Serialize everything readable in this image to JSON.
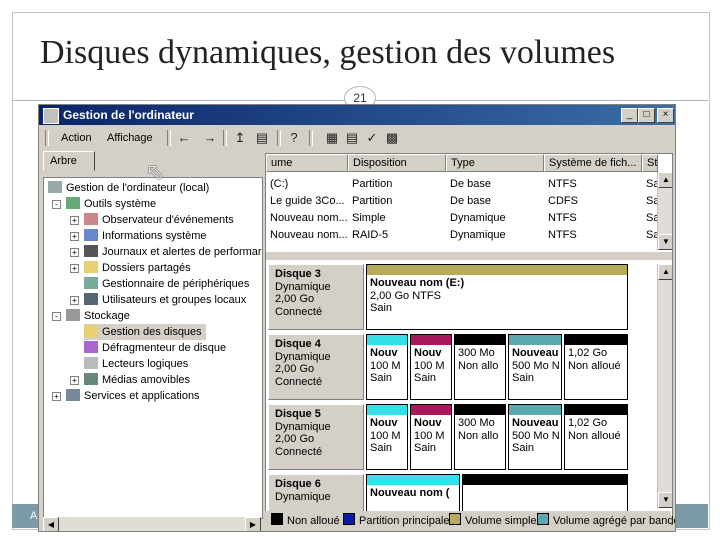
{
  "slide": {
    "title": "Disques dynamiques, gestion des volumes",
    "number": "21",
    "footer": "Ac"
  },
  "window": {
    "title": "Gestion de l'ordinateur",
    "menu": [
      "Action",
      "Affichage"
    ],
    "tab": "Arbre"
  },
  "tree": [
    {
      "label": "Gestion de l'ordinateur (local)",
      "icon": "computer-icon"
    },
    {
      "label": "Outils système",
      "icon": "tools-icon"
    },
    {
      "label": "Observateur d'événements",
      "icon": "event-viewer-icon"
    },
    {
      "label": "Informations système",
      "icon": "info-icon"
    },
    {
      "label": "Journaux et alertes de performar",
      "icon": "performance-icon"
    },
    {
      "label": "Dossiers partagés",
      "icon": "folder-icon"
    },
    {
      "label": "Gestionnaire de périphériques",
      "icon": "device-manager-icon"
    },
    {
      "label": "Utilisateurs et groupes locaux",
      "icon": "users-icon"
    },
    {
      "label": "Stockage",
      "icon": "storage-icon"
    },
    {
      "label": "Gestion des disques",
      "icon": "disk-management-icon"
    },
    {
      "label": "Défragmenteur de disque",
      "icon": "defrag-icon"
    },
    {
      "label": "Lecteurs logiques",
      "icon": "drive-icon"
    },
    {
      "label": "Médias amovibles",
      "icon": "removable-media-icon"
    },
    {
      "label": "Services et applications",
      "icon": "services-icon"
    }
  ],
  "volumes": {
    "columns": [
      "ume",
      "Disposition",
      "Type",
      "Système de fich...",
      "St"
    ],
    "rows": [
      [
        "(C:)",
        "Partition",
        "De base",
        "NTFS",
        "Sa"
      ],
      [
        "Le guide 3Co...",
        "Partition",
        "De base",
        "CDFS",
        "Sa"
      ],
      [
        "Nouveau nom...",
        "Simple",
        "Dynamique",
        "NTFS",
        "Sa"
      ],
      [
        "Nouveau nom...",
        "RAID-5",
        "Dynamique",
        "NTFS",
        "Sa"
      ]
    ]
  },
  "disks": [
    {
      "name": "Disque 3",
      "type": "Dynamique",
      "size": "2,00 Go",
      "status": "Connecté",
      "parts": [
        {
          "l1": "Nouveau nom  (E:)",
          "l2": "2,00 Go NTFS",
          "l3": "Sain",
          "color": "#b5a95a"
        }
      ]
    },
    {
      "name": "Disque 4",
      "type": "Dynamique",
      "size": "2,00 Go",
      "status": "Connecté",
      "parts": [
        {
          "l1": "Nouv",
          "l2": "100 M",
          "l3": "Sain",
          "color": "#33e0e8"
        },
        {
          "l1": "Nouv",
          "l2": "100 M",
          "l3": "Sain",
          "color": "#a8185a"
        },
        {
          "l1": "",
          "l2": "300 Mo",
          "l3": "Non allo",
          "color": "#000000"
        },
        {
          "l1": "Nouveau",
          "l2": "500 Mo N",
          "l3": "Sain",
          "color": "#5aa8b0"
        },
        {
          "l1": "",
          "l2": "1,02 Go",
          "l3": "Non alloué",
          "color": "#000000"
        }
      ]
    },
    {
      "name": "Disque 5",
      "type": "Dynamique",
      "size": "2,00 Go",
      "status": "Connecté",
      "parts": [
        {
          "l1": "Nouv",
          "l2": "100 M",
          "l3": "Sain",
          "color": "#33e0e8"
        },
        {
          "l1": "Nouv",
          "l2": "100 M",
          "l3": "Sain",
          "color": "#a8185a"
        },
        {
          "l1": "",
          "l2": "300 Mo",
          "l3": "Non allo",
          "color": "#000000"
        },
        {
          "l1": "Nouveau",
          "l2": "500 Mo N",
          "l3": "Sain",
          "color": "#5aa8b0"
        },
        {
          "l1": "",
          "l2": "1,02 Go",
          "l3": "Non alloué",
          "color": "#000000"
        }
      ]
    },
    {
      "name": "Disque 6",
      "type": "Dynamique",
      "size": "",
      "status": "",
      "parts": [
        {
          "l1": "Nouveau nom  (",
          "l2": "",
          "l3": "",
          "color": "#33e0e8"
        },
        {
          "l1": "",
          "l2": "",
          "l3": "",
          "color": "#000000"
        }
      ]
    }
  ],
  "legend": [
    {
      "label": "Non alloué",
      "color": "#000000"
    },
    {
      "label": "Partition principale",
      "color": "#0a1aa8"
    },
    {
      "label": "Volume simple",
      "color": "#b5a95a"
    },
    {
      "label": "Volume agrégé par bande",
      "color": "#5aa8b0"
    }
  ]
}
